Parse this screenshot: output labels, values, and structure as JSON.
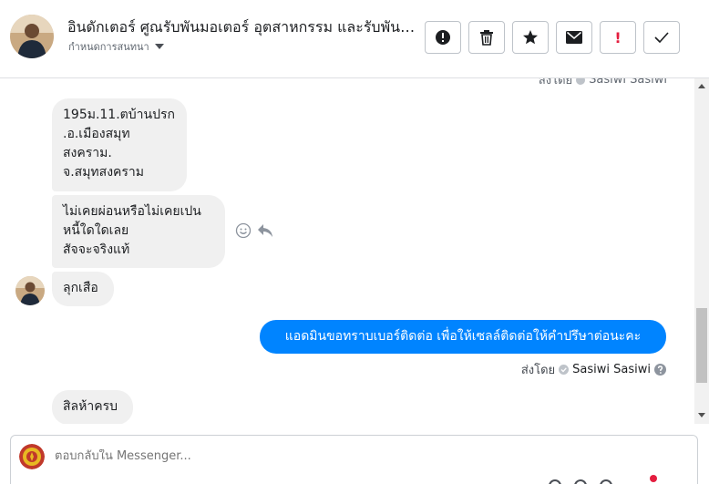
{
  "header": {
    "title": "อินดักเตอร์ ศูณรับพันมอเตอร์ อุตสาหกรรม และรับพันมอเตอร์",
    "subtitle": "กำหนดการสนทนา",
    "actions": [
      {
        "name": "spam-button",
        "icon": "exclamation-circle-icon"
      },
      {
        "name": "delete-button",
        "icon": "trash-icon"
      },
      {
        "name": "star-button",
        "icon": "star-icon"
      },
      {
        "name": "mark-unread-button",
        "icon": "envelope-icon"
      },
      {
        "name": "flag-button",
        "icon": "exclamation-icon",
        "label": "!"
      },
      {
        "name": "done-button",
        "icon": "check-icon"
      }
    ]
  },
  "thread": {
    "sent_by_top": {
      "label": "ส่งโดย",
      "name": "Sasiwi Sasiwi"
    },
    "messages": [
      {
        "lines": [
          "195ม.11.ตบ้านปรก",
          ".อ.เมืองสมุท",
          "สงคราม.",
          "จ.สมุทสงคราม"
        ]
      },
      {
        "lines": [
          "ไม่เคยผ่อนหรือไม่เคยเปน",
          "หนี้ใดใดเลย",
          "สัจจะจริงแท้"
        ]
      },
      {
        "lines": [
          "ลุกเสือ"
        ]
      },
      {
        "lines": [
          "สิลห้าครบ"
        ]
      }
    ],
    "outgoing": "แอดมินขอทราบเบอร์ติดต่อ เพื่อให้เซลล์ติดต่อให้คำปรึษาต่อนะคะ",
    "sent_by": {
      "label": "ส่งโดย",
      "name": "Sasiwi Sasiwi"
    }
  },
  "composer": {
    "placeholder": "ตอบกลับใน Messenger..."
  },
  "colors": {
    "accent": "#0084ff",
    "incoming_bubble": "#f0f0f0",
    "alert": "#e41e3f"
  }
}
